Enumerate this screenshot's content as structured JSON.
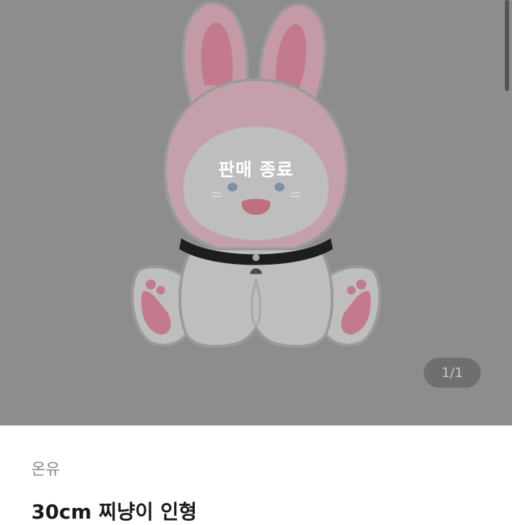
{
  "product_image": {
    "sold_out_label": "판매 종료",
    "page_counter": "1/1",
    "overlay_color": "#8d8d8d",
    "character_colors": {
      "ear_outer": "#c39aa6",
      "ear_inner": "#c37a8d",
      "hood": "#c3a0aa",
      "face": "#bebebe",
      "collar": "#1e1e1e",
      "nose": "#c06f7e",
      "eyes": "#7f8ea7"
    }
  },
  "product_info": {
    "seller_name": "온유",
    "title": "30cm 찌냥이 인형"
  }
}
